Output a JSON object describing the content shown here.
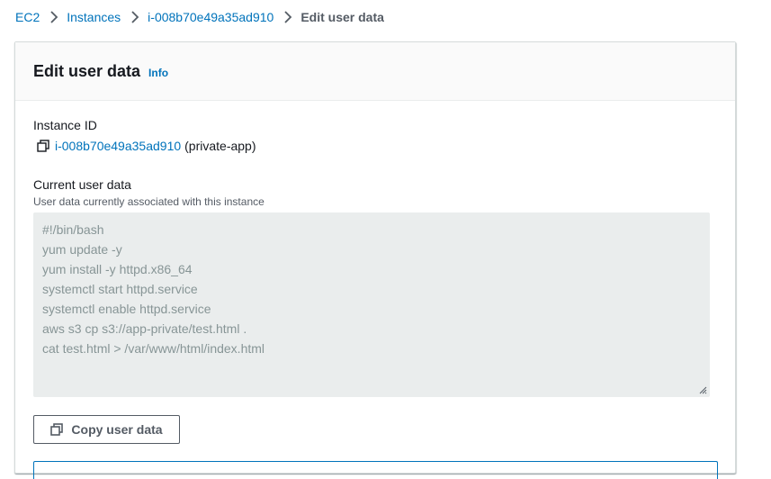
{
  "breadcrumb": {
    "items": [
      {
        "label": "EC2"
      },
      {
        "label": "Instances"
      },
      {
        "label": "i-008b70e49a35ad910"
      }
    ],
    "current": "Edit user data"
  },
  "panel": {
    "title": "Edit user data",
    "info_label": "Info"
  },
  "instance": {
    "label": "Instance ID",
    "id": "i-008b70e49a35ad910",
    "suffix": "(private-app)"
  },
  "user_data": {
    "label": "Current user data",
    "description": "User data currently associated with this instance",
    "lines": [
      "#!/bin/bash",
      "yum update -y",
      "yum install -y httpd.x86_64",
      "systemctl start httpd.service",
      "systemctl enable httpd.service",
      "aws s3 cp s3://app-private/test.html .",
      "cat test.html > /var/www/html/index.html"
    ]
  },
  "copy_button": {
    "label": "Copy user data"
  },
  "colors": {
    "link": "#0073bb",
    "readonly_bg": "#eaeded",
    "readonly_text": "#879596"
  }
}
